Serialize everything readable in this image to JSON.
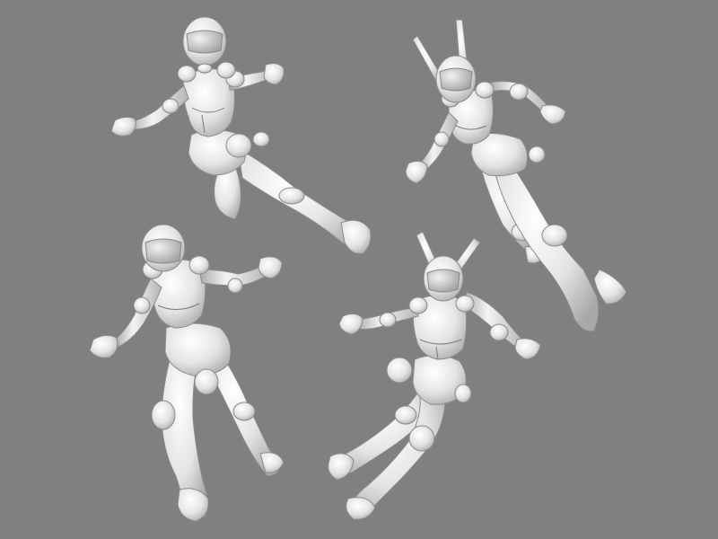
{
  "scene": {
    "background_color": "#808080",
    "figure_color": "#ebebeb",
    "shade_color": "#b9b9b9",
    "line_color": "#7a7a7a",
    "figures": [
      {
        "name": "figure-top-left-helmet"
      },
      {
        "name": "figure-top-right-antenna"
      },
      {
        "name": "figure-bottom-left-helmet"
      },
      {
        "name": "figure-bottom-right-antenna"
      }
    ]
  }
}
